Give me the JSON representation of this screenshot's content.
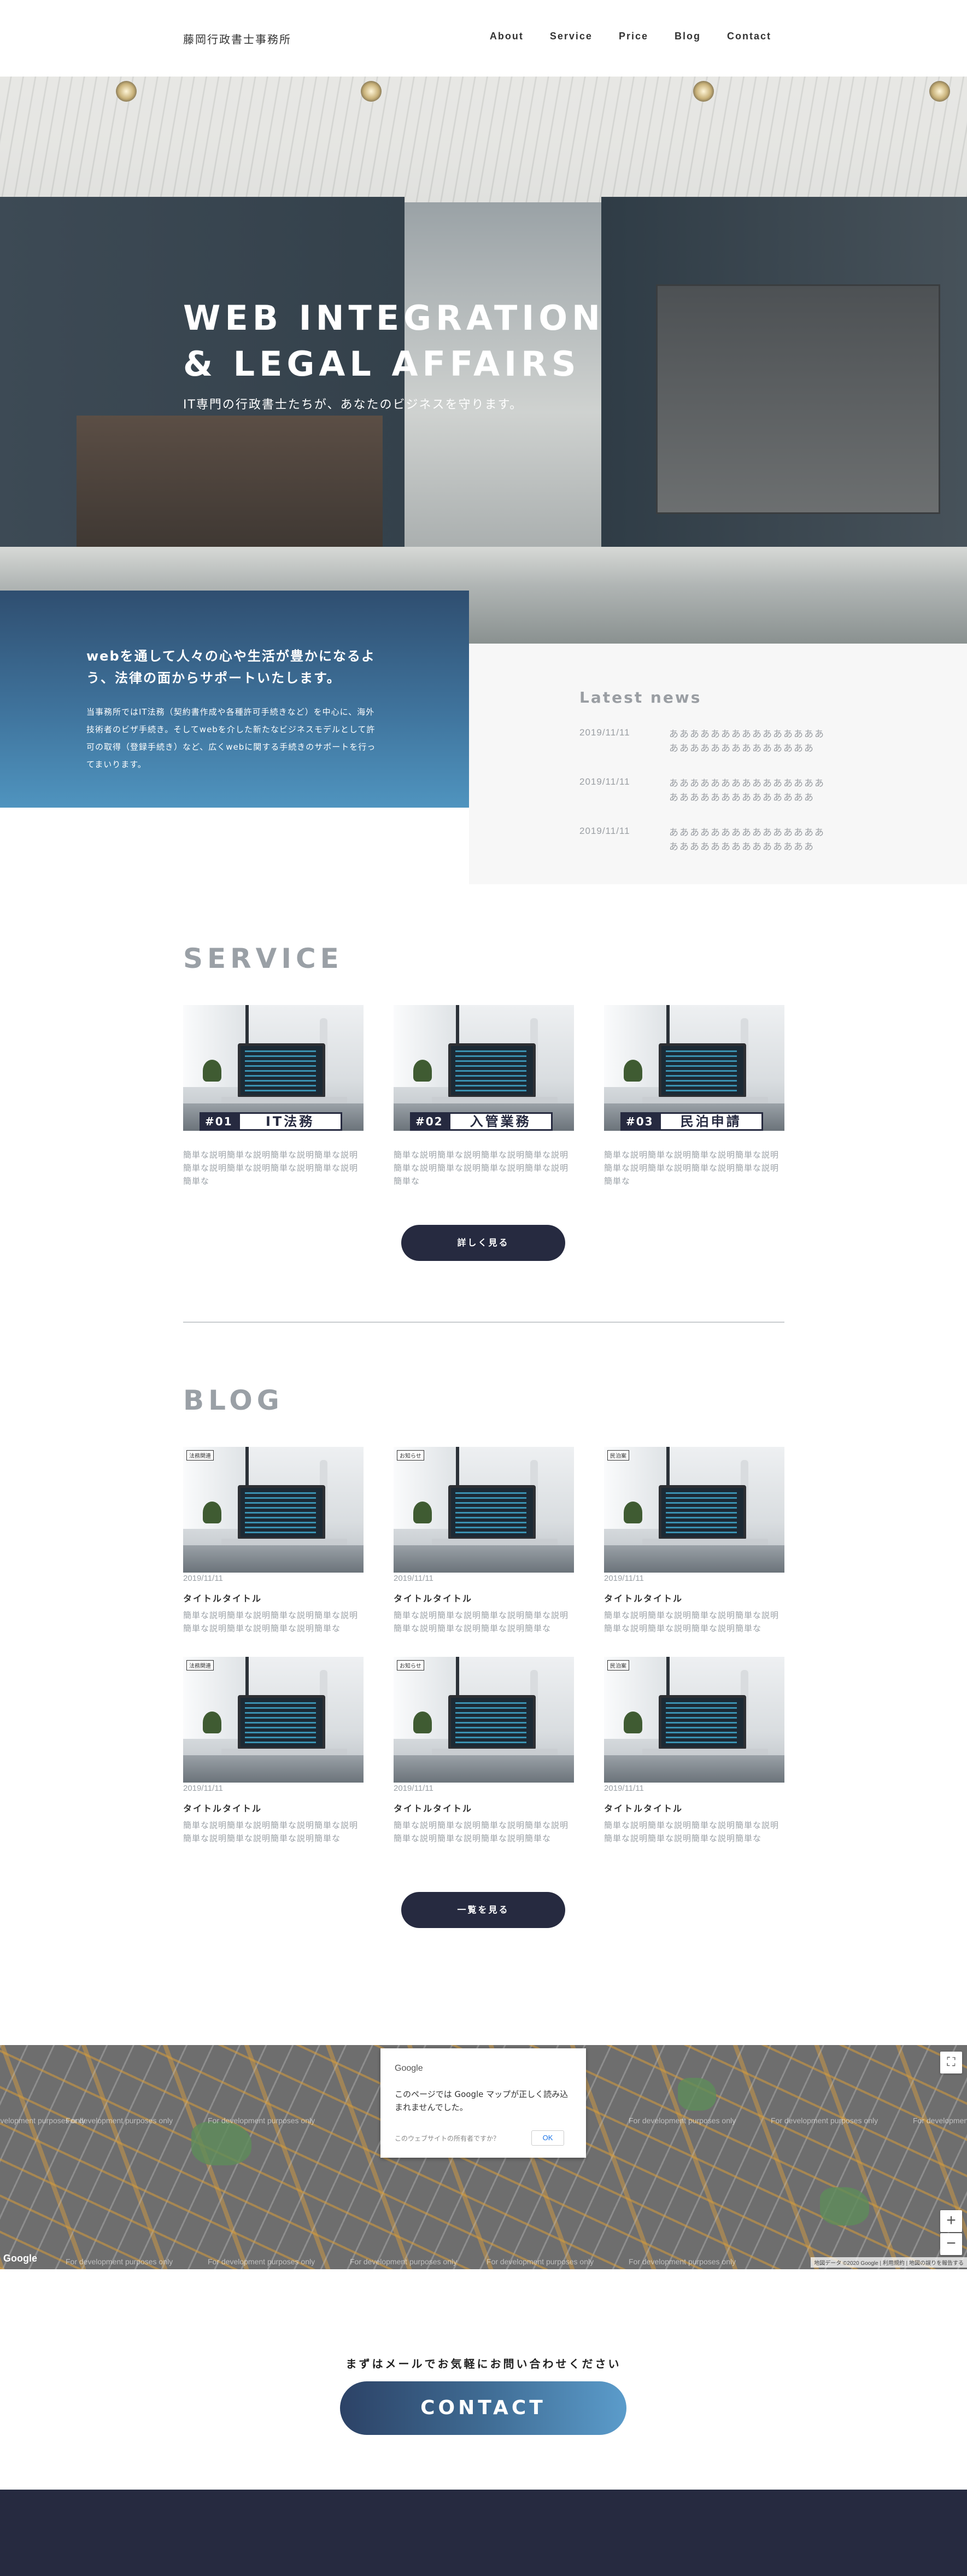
{
  "header": {
    "logo": "藤岡行政書士事務所",
    "nav": [
      "About",
      "Service",
      "Price",
      "Blog",
      "Contact"
    ]
  },
  "hero": {
    "title_line1": "WEB INTEGRATION",
    "title_line2": "& LEGAL AFFAIRS",
    "subtitle": "IT専門の行政書士たちが、あなたのビジネスを守ります。"
  },
  "intro": {
    "heading": "webを通して人々の心や生活が豊かになるよう、法律の面からサポートいたします。",
    "body": "当事務所ではIT法務（契約書作成や各種許可手続きなど）を中心に、海外技術者のビザ手続き。そしてwebを介した新たなビジネスモデルとして許可の取得（登録手続き）など、広くwebに関する手続きのサポートを行ってまいります。"
  },
  "news": {
    "title": "Latest news",
    "items": [
      {
        "date": "2019/11/11",
        "text": "あああああああああああああああああああああああああああああ"
      },
      {
        "date": "2019/11/11",
        "text": "あああああああああああああああああああああああああああああ"
      },
      {
        "date": "2019/11/11",
        "text": "あああああああああああああああああああああああああああああ"
      }
    ]
  },
  "service": {
    "title": "SERVICE",
    "items": [
      {
        "num": "#01",
        "name": "IT法務",
        "desc": "簡単な説明簡単な説明簡単な説明簡単な説明簡単な説明簡単な説明簡単な説明簡単な説明簡単な"
      },
      {
        "num": "#02",
        "name": "入管業務",
        "desc": "簡単な説明簡単な説明簡単な説明簡単な説明簡単な説明簡単な説明簡単な説明簡単な説明簡単な"
      },
      {
        "num": "#03",
        "name": "民泊申請",
        "desc": "簡単な説明簡単な説明簡単な説明簡単な説明簡単な説明簡単な説明簡単な説明簡単な説明簡単な"
      }
    ],
    "button": "詳しく見る"
  },
  "blog": {
    "title": "BLOG",
    "posts": [
      {
        "tag": "法務関連",
        "date": "2019/11/11",
        "title": "タイトルタイトル",
        "desc": "簡単な説明簡単な説明簡単な説明簡単な説明簡単な説明簡単な説明簡単な説明簡単な"
      },
      {
        "tag": "お知らせ",
        "date": "2019/11/11",
        "title": "タイトルタイトル",
        "desc": "簡単な説明簡単な説明簡単な説明簡単な説明簡単な説明簡単な説明簡単な説明簡単な"
      },
      {
        "tag": "民泊案",
        "date": "2019/11/11",
        "title": "タイトルタイトル",
        "desc": "簡単な説明簡単な説明簡単な説明簡単な説明簡単な説明簡単な説明簡単な説明簡単な"
      },
      {
        "tag": "法務関連",
        "date": "2019/11/11",
        "title": "タイトルタイトル",
        "desc": "簡単な説明簡単な説明簡単な説明簡単な説明簡単な説明簡単な説明簡単な説明簡単な"
      },
      {
        "tag": "お知らせ",
        "date": "2019/11/11",
        "title": "タイトルタイトル",
        "desc": "簡単な説明簡単な説明簡単な説明簡単な説明簡単な説明簡単な説明簡単な説明簡単な"
      },
      {
        "tag": "民泊案",
        "date": "2019/11/11",
        "title": "タイトルタイトル",
        "desc": "簡単な説明簡単な説明簡単な説明簡単な説明簡単な説明簡単な説明簡単な説明簡単な"
      }
    ],
    "button": "一覧を見る"
  },
  "map": {
    "dialog_brand": "Google",
    "dialog_message": "このページでは Google マップが正しく読み込まれませんでした。",
    "dialog_own": "このウェブサイトの所有者ですか？",
    "dialog_ok": "OK",
    "watermark": "For development purposes only",
    "logo": "Google",
    "credit": "地図データ ©2020 Google | 利用規約 | 地図の誤りを報告する",
    "zoom_in": "+",
    "zoom_out": "−",
    "fullscreen": "⛶"
  },
  "contact": {
    "lead": "まずはメールでお気軽にお問い合わせください",
    "button": "CONTACT"
  }
}
